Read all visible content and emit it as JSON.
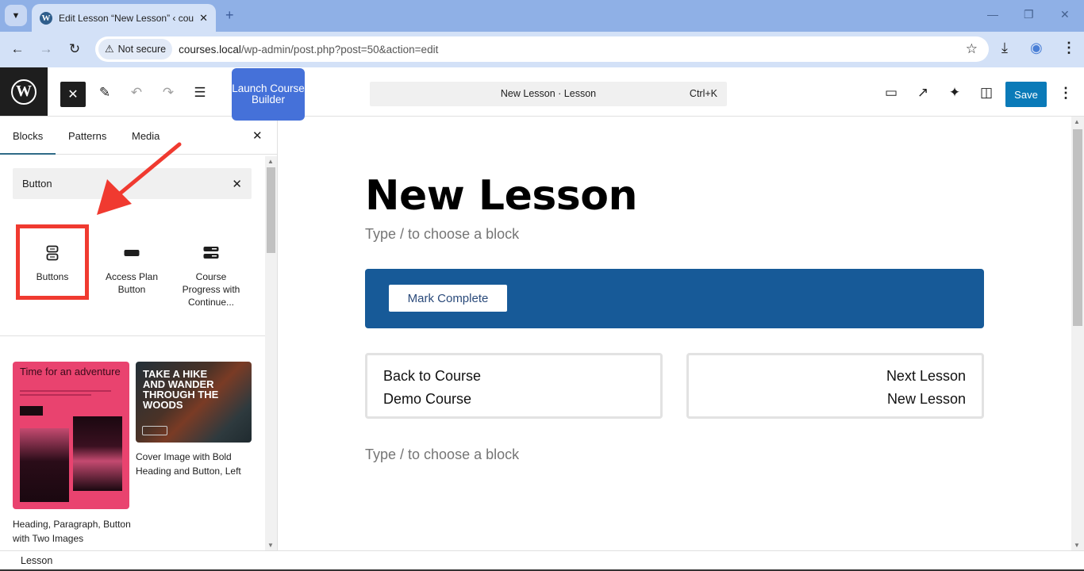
{
  "browser": {
    "tab_title": "Edit Lesson “New Lesson” ‹ cou",
    "security_label": "Not secure",
    "url_host": "courses.local",
    "url_path": "/wp-admin/post.php?post=50&action=edit"
  },
  "header": {
    "launch_button": "Launch Course Builder",
    "command_title": "New Lesson · Lesson",
    "command_shortcut": "Ctrl+K",
    "save_label": "Save"
  },
  "sidebar": {
    "tabs": [
      {
        "label": "Blocks",
        "active": true
      },
      {
        "label": "Patterns",
        "active": false
      },
      {
        "label": "Media",
        "active": false
      }
    ],
    "search_value": "Button",
    "search_placeholder": "Search",
    "blocks": [
      {
        "label": "Buttons",
        "icon": "buttons-icon",
        "highlighted": true
      },
      {
        "label": "Access Plan Button",
        "icon": "button-icon",
        "highlighted": false
      },
      {
        "label": "Course Progress with Continue...",
        "icon": "course-progress-icon",
        "highlighted": false
      }
    ],
    "patterns": [
      {
        "label": "Heading, Paragraph, Button with Two Images",
        "preview_heading": "Time for an adventure"
      },
      {
        "label": "Cover Image with Bold Heading and Button, Left",
        "preview_heading": "TAKE A HIKE AND WANDER THROUGH THE WOODS"
      }
    ]
  },
  "canvas": {
    "title": "New Lesson",
    "placeholder1": "Type / to choose a block",
    "mark_complete_label": "Mark Complete",
    "back_card": {
      "label": "Back to Course",
      "value": "Demo Course"
    },
    "next_card": {
      "label": "Next Lesson",
      "value": "New Lesson"
    },
    "placeholder2": "Type / to choose a block"
  },
  "footer": {
    "breadcrumb": "Lesson"
  },
  "colors": {
    "save_button": "#0a7ab8",
    "launch_button": "#4571d9",
    "mark_block": "#175a98",
    "annotation": "#f03a30"
  }
}
